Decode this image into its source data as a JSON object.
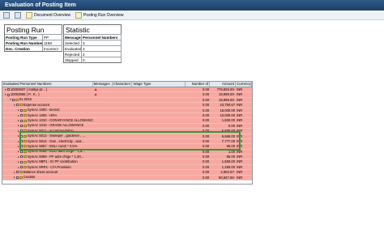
{
  "window": {
    "title": "Evaluation of Posting Item"
  },
  "toolbar": {
    "doc_overview": "Document Overview",
    "posting_run_overview": "Posting Run Overview"
  },
  "posting_run": {
    "title": "Posting Run",
    "rows": [
      {
        "label": "Posting Run Type",
        "value": "PP"
      },
      {
        "label": "Posting Run Number",
        "value": "1158"
      },
      {
        "label": "Doc. Creation",
        "value": "Incorrect"
      }
    ]
  },
  "statistic": {
    "title": "Statistic",
    "header": {
      "label": "Messages",
      "value": "Personnel Numbers"
    },
    "rows": [
      {
        "label": "Selected",
        "value": "3"
      },
      {
        "label": "Evaluated",
        "value": "3"
      },
      {
        "label": "Rejected",
        "value": "2"
      },
      {
        "label": "Skipped",
        "value": "0"
      }
    ]
  },
  "grid": {
    "columns": [
      "Evaluated Personnel Numbers",
      "Messages",
      "Characters",
      "Wage Type",
      "Number of",
      "Amount",
      "Currency"
    ],
    "rows": [
      {
        "name": "10003637 ( maltya pr... )",
        "warn": true,
        "num": "0.00",
        "amt": "776,825.00-",
        "cur": "INR"
      },
      {
        "name": "10003696 ( P.. K.. )",
        "warn": true,
        "num": "0.00",
        "amt": "19,999.00-",
        "cur": "INR"
      },
      {
        "name": "01.2015",
        "warn": false,
        "num": "0.00",
        "amt": "19,999.00-",
        "cur": "INR"
      },
      {
        "name": "Expense account",
        "warn": false,
        "num": "0.00",
        "amt": "43,750.67",
        "cur": "INR"
      },
      {
        "name": "SymAc 1000 - BASIC",
        "warn": false,
        "num": "0.00",
        "amt": "18,000.00",
        "cur": "INR"
      },
      {
        "name": "SymAc 1005 - HRA",
        "warn": false,
        "num": "0.00",
        "amt": "10,000.00",
        "cur": "INR"
      },
      {
        "name": "SymAc 1010 - CONVEYANCE ALLOWANCE",
        "warn": false,
        "num": "0.00",
        "amt": "1,600.00",
        "cur": "INR"
      },
      {
        "name": "SymAc 1015 - GRADE ALLOWANCE",
        "warn": false,
        "num": "0.00",
        "amt": "0.00",
        "cur": "INR"
      },
      {
        "name": "SymAc 5011 - Accommodation",
        "warn": false,
        "num": "0.00",
        "amt": "5,555.00",
        "cur": "INR"
      },
      {
        "name": "SymAc 5013 - Sweeper , gardener , ...",
        "warn": false,
        "num": "0.00",
        "amt": "6,666.00",
        "cur": "INR"
      },
      {
        "name": "SymAc 5014 - Gas , electricity , wat...",
        "warn": false,
        "num": "0.00",
        "amt": "7,777.00",
        "cur": "INR"
      },
      {
        "name": "SymAc 9067 - EDLI contri * 0.5%",
        "warn": false,
        "num": "0.00",
        "amt": "65.00",
        "cur": "INR"
      },
      {
        "name": "SymAc 9068 - EDLI adm chrge * 1,8...",
        "warn": false,
        "num": "0.00",
        "amt": "1.00",
        "cur": "INR"
      },
      {
        "name": "SymAc 9069 - PF adm chrge * 1,00...",
        "warn": false,
        "num": "0.00",
        "amt": "65.00",
        "cur": "INR"
      },
      {
        "name": "SymAc 9BP1 - Er PF contribution",
        "warn": false,
        "num": "0.00",
        "amt": "1,560.00",
        "cur": "INR"
      },
      {
        "name": "SymAc 9RP4 - LTA Provision",
        "warn": false,
        "num": "0.00",
        "amt": "1,250.00",
        "cur": "INR"
      },
      {
        "name": "Balance sheet account",
        "warn": false,
        "num": "0.00",
        "amt": "2,902.67-",
        "cur": "INR"
      },
      {
        "name": "Creditor",
        "warn": false,
        "num": "0.00",
        "amt": "60,847.00-",
        "cur": "INR"
      }
    ]
  }
}
